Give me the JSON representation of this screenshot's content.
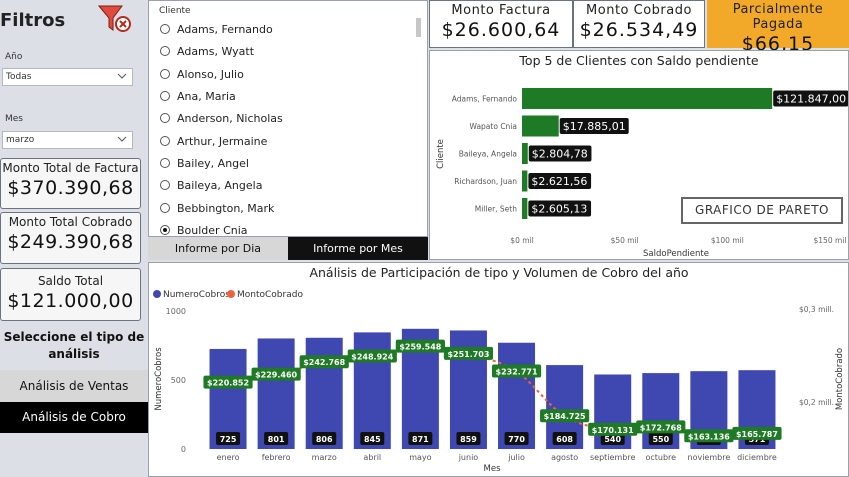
{
  "filters": {
    "title": "Filtros",
    "year_label": "Año",
    "year_value": "Todas",
    "month_label": "Mes",
    "month_value": "marzo"
  },
  "kpis_left": [
    {
      "label": "Monto Total de Factura",
      "value": "$370.390,68"
    },
    {
      "label": "Monto Total Cobrado",
      "value": "$249.390,68"
    },
    {
      "label": "Saldo Total",
      "value": "$121.000,00"
    }
  ],
  "analysis": {
    "prompt": "Seleccione el tipo de análisis",
    "ventas": "Análisis de Ventas",
    "cobro": "Análisis de Cobro"
  },
  "slicer": {
    "title": "Cliente",
    "items": [
      "Adams, Fernando",
      "Adams, Wyatt",
      "Alonso, Julio",
      "Ana, Maria",
      "Anderson, Nicholas",
      "Arthur, Jermaine",
      "Bailey, Angel",
      "Baileya, Angela",
      "Bebbington, Mark",
      "Boulder Cnia"
    ],
    "selected": "Boulder Cnia"
  },
  "tabs": {
    "dia": "Informe por Dia",
    "mes": "Informe por Mes"
  },
  "kpis_top": [
    {
      "label": "Monto Factura",
      "value": "$26.600,64"
    },
    {
      "label": "Monto Cobrado",
      "value": "$26.534,49"
    },
    {
      "label": "Parcialmente Pagada",
      "value": "$66,15"
    }
  ],
  "pareto_button": "GRAFICO DE PARETO",
  "chart_data": [
    {
      "type": "bar",
      "orientation": "horizontal",
      "title": "Top 5 de Clientes con Saldo pendiente",
      "xlabel": "SaldoPendiente",
      "ylabel": "Cliente",
      "categories": [
        "Adams, Fernando",
        "Wapato Cnia",
        "Baileya, Angela",
        "Richardson, Juan",
        "Miller, Seth"
      ],
      "values": [
        121847.0,
        17885.01,
        2804.78,
        2621.56,
        2605.13
      ],
      "data_labels": [
        "$121.847,00",
        "$17.885,01",
        "$2.804,78",
        "$2.621,56",
        "$2.605,13"
      ],
      "xticks": [
        "$0 mil",
        "$50 mil",
        "$100 mil",
        "$150 mil"
      ],
      "xlim": [
        0,
        150000
      ],
      "color": "#1f7a26"
    },
    {
      "type": "bar",
      "title": "Análisis de Participación de tipo y Volumen de Cobro del año",
      "xlabel": "Mes",
      "ylabel": "NumeroCobros",
      "y2label": "MontoCobrado",
      "legend": [
        "NumeroCobros",
        "MontoCobrado"
      ],
      "legend_position": "top-left",
      "yticks": [
        "0",
        "500",
        "1000"
      ],
      "ylim": [
        0,
        1000
      ],
      "y2ticks": [
        "$0,2 mill.",
        "$0,3 mill."
      ],
      "categories": [
        "enero",
        "febrero",
        "marzo",
        "abril",
        "mayo",
        "junio",
        "julio",
        "agosto",
        "septiembre",
        "octubre",
        "noviembre",
        "diciembre"
      ],
      "series": [
        {
          "name": "NumeroCobros",
          "type": "bar",
          "color": "#3f48b0",
          "values": [
            725,
            801,
            806,
            845,
            871,
            859,
            770,
            608,
            540,
            550,
            564,
            571
          ]
        },
        {
          "name": "MontoCobrado",
          "type": "line",
          "color": "#f0623a",
          "values": [
            220852,
            229460,
            242768,
            248924,
            259548,
            251703,
            232771,
            184725,
            170131,
            172768,
            163136,
            165787
          ],
          "labels": [
            "$220.852",
            "$229.460",
            "$242.768",
            "$248.924",
            "$259.548",
            "$251.703",
            "$232.771",
            "$184.725",
            "$170.131",
            "$172.768",
            "$163.136",
            "$165.787"
          ]
        }
      ]
    }
  ]
}
